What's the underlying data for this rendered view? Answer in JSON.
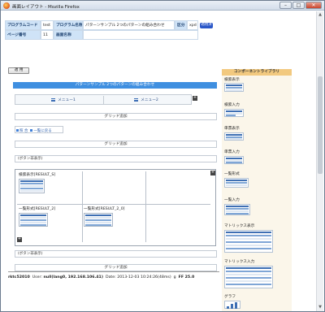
{
  "window": {
    "title": "画面レイアウト - Mozilla Firefox",
    "controls": [
      "–",
      "□",
      "✕"
    ]
  },
  "header": {
    "program_code_label": "プログラムコード",
    "program_code_value": "test",
    "program_name_label": "プログラム名称",
    "program_name_value": "パターンサンプル 2つのパターンの組み合わせ",
    "kubun_label": "区分",
    "kubun_value": "xpd",
    "badge": "適用済",
    "page_no_label": "ページ番号",
    "page_no_value": "11",
    "table_name_label": "画面名称"
  },
  "toolbar": {
    "apply_label": "適 用"
  },
  "main": {
    "title_bar": "パターンサンプル 2つのパターンの組み合わせ",
    "menu_tabs": [
      "メニュー1",
      "メニュー2"
    ],
    "add_symbol": "+",
    "grid_add_1": "グリッド追加",
    "links": [
      "照 合",
      "一覧に戻る"
    ],
    "grid_add_2": "グリッド追加",
    "button_note_1": "(ボタン非表示)",
    "results": [
      {
        "label": "検索表示[RESULT_S]"
      },
      {
        "label": "一覧形式[RESULT_2]"
      },
      {
        "label": "一覧形式[RESULT_2_0]"
      }
    ],
    "button_note_2": "(ボタン非表示)",
    "grid_add_3": "グリッド追加"
  },
  "footer": {
    "host": "rktc52010",
    "user_label": "User:",
    "user_value": "null(lang0, 192.168.106.41)",
    "date_label": "Date:",
    "date_value": "2013-12-03 10:24:26(48ms)",
    "g": "g",
    "browser": "FF 25.0"
  },
  "library": {
    "title": "コンポーネントライブラリ",
    "items": [
      "検索表示",
      "検索入力",
      "単票表示",
      "単票入力",
      "一覧形式",
      "一覧入力",
      "マトリックス表示",
      "マトリックス入力",
      "グラフ"
    ]
  },
  "colors": {
    "accent_blue": "#3f8fe0",
    "header_label_bg": "#cfe3f7",
    "library_head": "#f2c97f",
    "library_bg": "#fbf6ea"
  }
}
